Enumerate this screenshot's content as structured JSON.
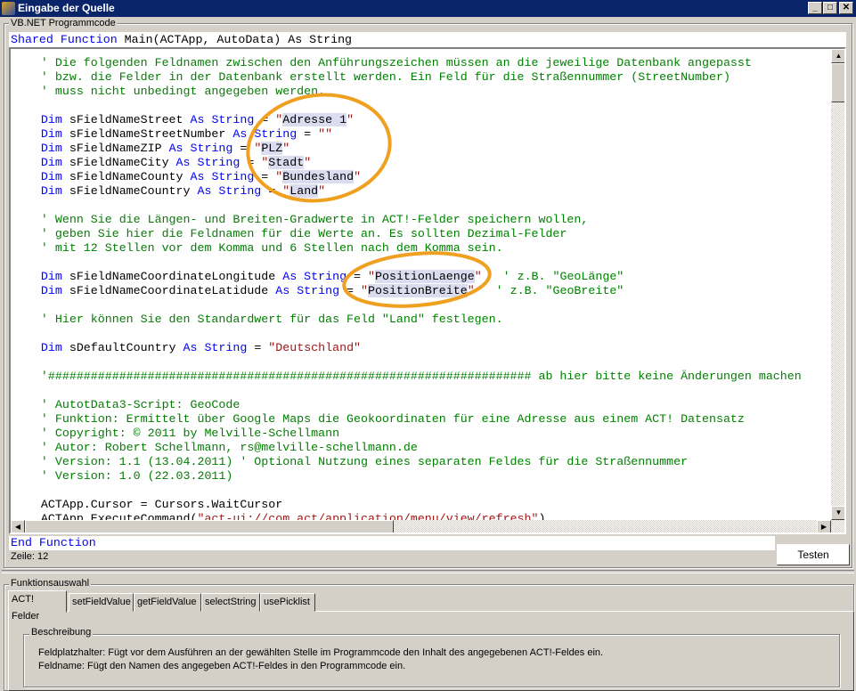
{
  "window": {
    "title": "Eingabe der Quelle",
    "minimize": "_",
    "maximize": "□",
    "close": "✕"
  },
  "code_group": {
    "label": "VB.NET Programmcode"
  },
  "header_line": [
    [
      "kw",
      "Shared Function"
    ],
    [
      "id",
      " Main(ACTApp, AutoData) As String"
    ]
  ],
  "code_lines": [
    [
      [
        "com",
        "    ' Die folgenden Feldnamen zwischen den Anführungszeichen müssen an die jeweilige Datenbank angepasst"
      ]
    ],
    [
      [
        "com",
        "    ' bzw. die Felder in der Datenbank erstellt werden. Ein Feld für die Straßennummer (StreetNumber)"
      ]
    ],
    [
      [
        "com",
        "    ' muss nicht unbedingt angegeben werden."
      ]
    ],
    [],
    [
      [
        "kw",
        "    Dim"
      ],
      [
        "id",
        " sFieldNameStreet "
      ],
      [
        "kw",
        "As String"
      ],
      [
        "id",
        " = "
      ],
      [
        "str",
        "\""
      ],
      [
        "hl",
        "Adresse 1"
      ],
      [
        "str",
        "\""
      ]
    ],
    [
      [
        "kw",
        "    Dim"
      ],
      [
        "id",
        " sFieldNameStreetNumber "
      ],
      [
        "kw",
        "As String"
      ],
      [
        "id",
        " = "
      ],
      [
        "str",
        "\"\""
      ]
    ],
    [
      [
        "kw",
        "    Dim"
      ],
      [
        "id",
        " sFieldNameZIP "
      ],
      [
        "kw",
        "As String"
      ],
      [
        "id",
        " = "
      ],
      [
        "str",
        "\""
      ],
      [
        "hl",
        "PLZ"
      ],
      [
        "str",
        "\""
      ]
    ],
    [
      [
        "kw",
        "    Dim"
      ],
      [
        "id",
        " sFieldNameCity "
      ],
      [
        "kw",
        "As String"
      ],
      [
        "id",
        " = "
      ],
      [
        "str",
        "\""
      ],
      [
        "hl",
        "Stadt"
      ],
      [
        "str",
        "\""
      ]
    ],
    [
      [
        "kw",
        "    Dim"
      ],
      [
        "id",
        " sFieldNameCounty "
      ],
      [
        "kw",
        "As String"
      ],
      [
        "id",
        " = "
      ],
      [
        "str",
        "\""
      ],
      [
        "hl",
        "Bundesland"
      ],
      [
        "str",
        "\""
      ]
    ],
    [
      [
        "kw",
        "    Dim"
      ],
      [
        "id",
        " sFieldNameCountry "
      ],
      [
        "kw",
        "As String"
      ],
      [
        "id",
        " = "
      ],
      [
        "str",
        "\""
      ],
      [
        "hl",
        "Land"
      ],
      [
        "str",
        "\""
      ]
    ],
    [],
    [
      [
        "com",
        "    ' Wenn Sie die Längen- und Breiten-Gradwerte in ACT!-Felder speichern wollen,"
      ]
    ],
    [
      [
        "com",
        "    ' geben Sie hier die Feldnamen für die Werte an. Es sollten Dezimal-Felder"
      ]
    ],
    [
      [
        "com",
        "    ' mit 12 Stellen vor dem Komma und 6 Stellen nach dem Komma sein."
      ]
    ],
    [],
    [
      [
        "kw",
        "    Dim"
      ],
      [
        "id",
        " sFieldNameCoordinateLongitude "
      ],
      [
        "kw",
        "As String"
      ],
      [
        "id",
        " = "
      ],
      [
        "str",
        "\""
      ],
      [
        "hl",
        "PositionLaenge"
      ],
      [
        "str",
        "\""
      ],
      [
        "com",
        "   ' z.B. \"GeoLänge\""
      ]
    ],
    [
      [
        "kw",
        "    Dim"
      ],
      [
        "id",
        " sFieldNameCoordinateLatidude "
      ],
      [
        "kw",
        "As String"
      ],
      [
        "id",
        " = "
      ],
      [
        "str",
        "\""
      ],
      [
        "hl",
        "PositionBreite"
      ],
      [
        "str",
        "\""
      ],
      [
        "com",
        "   ' z.B. \"GeoBreite\""
      ]
    ],
    [],
    [
      [
        "com",
        "    ' Hier können Sie den Standardwert für das Feld \"Land\" festlegen."
      ]
    ],
    [],
    [
      [
        "kw",
        "    Dim"
      ],
      [
        "id",
        " sDefaultCountry "
      ],
      [
        "kw",
        "As String"
      ],
      [
        "id",
        " = "
      ],
      [
        "str",
        "\"Deutschland\""
      ]
    ],
    [],
    [
      [
        "com",
        "    '#################################################################### ab hier bitte keine Änderungen machen"
      ]
    ],
    [],
    [
      [
        "com",
        "    ' AutotData3-Script: GeoCode"
      ]
    ],
    [
      [
        "com",
        "    ' Funktion: Ermittelt über Google Maps die Geokoordinaten für eine Adresse aus einem ACT! Datensatz"
      ]
    ],
    [
      [
        "com",
        "    ' Copyright: © 2011 by Melville-Schellmann"
      ]
    ],
    [
      [
        "com",
        "    ' Autor: Robert Schellmann, rs@melville-schellmann.de"
      ]
    ],
    [
      [
        "com",
        "    ' Version: 1.1 (13.04.2011) ' Optional Nutzung eines separaten Feldes für die Straßennummer"
      ]
    ],
    [
      [
        "com",
        "    ' Version: 1.0 (22.03.2011)"
      ]
    ],
    [],
    [
      [
        "id",
        "    ACTApp.Cursor = Cursors.WaitCursor"
      ]
    ],
    [
      [
        "id",
        "    ACTApp.ExecuteCommand("
      ],
      [
        "str",
        "\"act-ui://com.act/application/menu/view/refresh\""
      ],
      [
        "id",
        ")"
      ]
    ]
  ],
  "footer_line": [
    [
      "kw",
      "End Function"
    ]
  ],
  "status": {
    "line": "Zeile: 12"
  },
  "test_button": "Testen",
  "function_group": {
    "label": "Funktionsauswahl",
    "tabs": [
      "ACT! Felder",
      "setFieldValue",
      "getFieldValue",
      "selectString",
      "usePicklist"
    ],
    "active_tab": "ACT! Felder"
  },
  "description": {
    "label": "Beschreibung",
    "lines": [
      "Feldplatzhalter: Fügt vor dem Ausführen an der gewählten Stelle im Programmcode den Inhalt des angegebenen ACT!-Feldes ein.",
      "Feldname: Fügt den Namen des angegeben ACT!-Feldes in den Programmcode ein."
    ]
  },
  "colors": {
    "keyword": "#0000ff",
    "string": "#a31515",
    "comment": "#008000",
    "highlight": "#dcdcf0",
    "annotation": "#f0a020",
    "titlebar": "#0a246a"
  }
}
